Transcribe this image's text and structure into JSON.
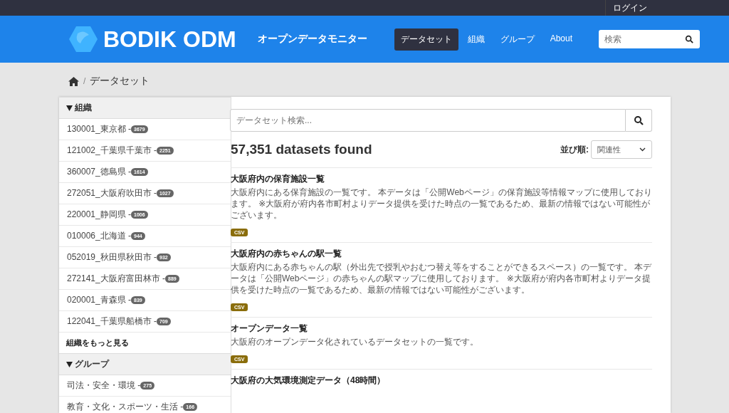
{
  "top_bar": {
    "login": "ログイン"
  },
  "header": {
    "brand": "BODIK ODM",
    "subtitle": "オープンデータモニター",
    "nav": [
      {
        "label": "データセット",
        "selected": true
      },
      {
        "label": "組織",
        "selected": false
      },
      {
        "label": "グループ",
        "selected": false
      },
      {
        "label": "About",
        "selected": false
      }
    ],
    "search": {
      "placeholder": "検索"
    }
  },
  "breadcrumb": {
    "separator": "/",
    "current": "データセット"
  },
  "sidebar": {
    "sections": [
      {
        "title": "組織",
        "items": [
          {
            "label": "130001_東京都 - ",
            "count": "3679"
          },
          {
            "label": "121002_千葉県千葉市 - ",
            "count": "2251"
          },
          {
            "label": "360007_徳島県 - ",
            "count": "1614"
          },
          {
            "label": "272051_大阪府吹田市 - ",
            "count": "1027"
          },
          {
            "label": "220001_静岡県 - ",
            "count": "1006"
          },
          {
            "label": "010006_北海道 - ",
            "count": "944"
          },
          {
            "label": "052019_秋田県秋田市 - ",
            "count": "932"
          },
          {
            "label": "272141_大阪府富田林市 - ",
            "count": "889"
          },
          {
            "label": "020001_青森県 - ",
            "count": "839"
          },
          {
            "label": "122041_千葉県船橋市 - ",
            "count": "709"
          }
        ],
        "more": "組織をもっと見る"
      },
      {
        "title": "グループ",
        "items": [
          {
            "label": "司法・安全・環境 - ",
            "count": "275"
          },
          {
            "label": "教育・文化・スポーツ・生活 - ",
            "count": "166"
          }
        ]
      }
    ]
  },
  "search": {
    "placeholder": "データセット検索..."
  },
  "results": {
    "count_text": "57,351 datasets found",
    "sort_label": "並び順:",
    "sort_value": "関連性"
  },
  "datasets": [
    {
      "title": "大阪府内の保育施設一覧",
      "description": "大阪府内にある保育施設の一覧です。 本データは「公開Webページ」の保育施設等情報マップに使用しております。 ※大阪府が府内各市町村よりデータ提供を受けた時点の一覧であるため、最新の情報ではない可能性がございます。",
      "formats": [
        "CSV"
      ]
    },
    {
      "title": "大阪府内の赤ちゃんの駅一覧",
      "description": "大阪府内にある赤ちゃんの駅（外出先で授乳やおむつ替え等をすることができるスペース）の一覧です。 本データは「公開Webページ」の赤ちゃんの駅マップに使用しております。 ※大阪府が府内各市町村よりデータ提供を受けた時点の一覧であるため、最新の情報ではない可能性がございます。",
      "formats": [
        "CSV"
      ]
    },
    {
      "title": "オープンデータ一覧",
      "description": "大阪府のオープンデータ化されているデータセットの一覧です。",
      "formats": [
        "CSV"
      ]
    },
    {
      "title": "大阪府の大気環境測定データ（48時間）"
    }
  ]
}
